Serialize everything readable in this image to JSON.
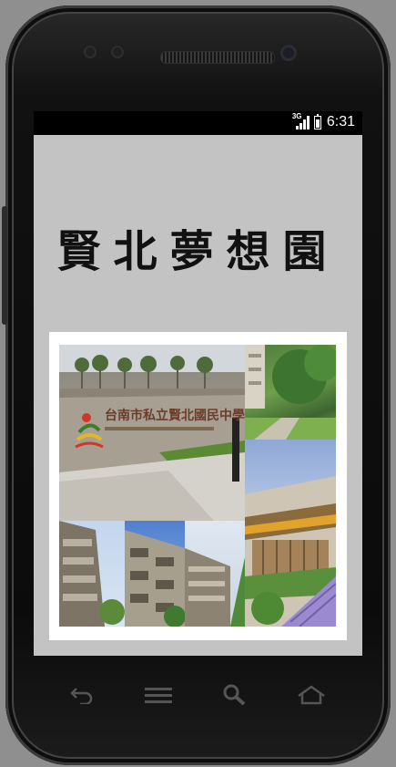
{
  "status_bar": {
    "network": "3G",
    "time": "6:31",
    "signal_icon": "signal-icon",
    "battery_icon": "battery-icon"
  },
  "app": {
    "title": "賢北夢想園"
  },
  "image": {
    "sign_text": "台南市私立賢北國民中學"
  },
  "nav_bar": {
    "buttons": [
      "back-icon",
      "menu-icon",
      "search-icon",
      "home-icon"
    ]
  }
}
